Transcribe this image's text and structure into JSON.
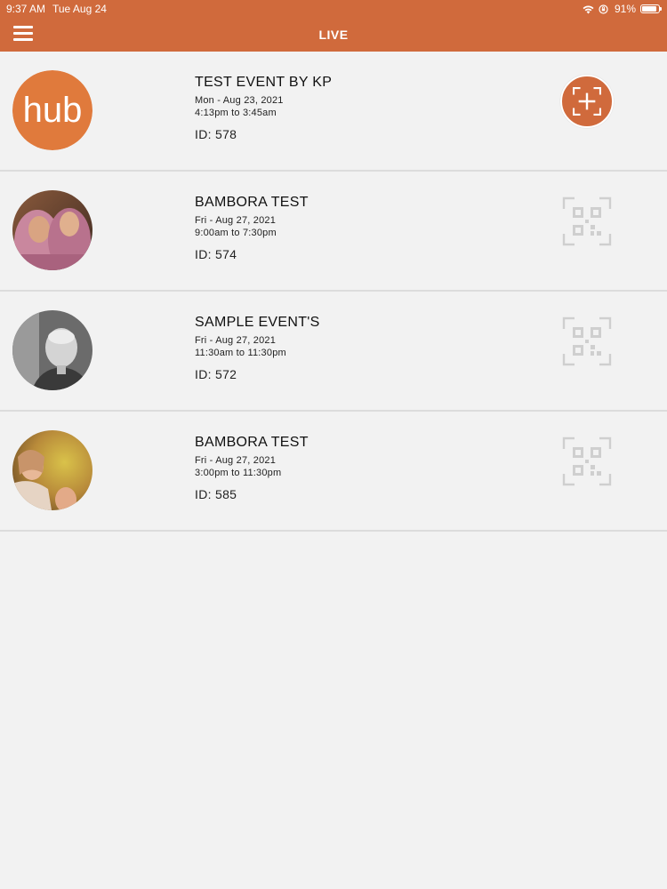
{
  "status_bar": {
    "time": "9:37 AM",
    "date": "Tue Aug 24",
    "battery": "91%"
  },
  "header": {
    "title": "LIVE"
  },
  "events": [
    {
      "title": "TEST EVENT BY KP",
      "date": "Mon - Aug 23, 2021",
      "time": "4:13pm to 3:45am",
      "id": "ID: 578",
      "avatar": "hub-logo",
      "action": "add-scan"
    },
    {
      "title": "BAMBORA TEST",
      "date": "Fri - Aug 27, 2021",
      "time": "9:00am to 7:30pm",
      "id": "ID: 574",
      "avatar": "photo-two-women",
      "action": "qr-scan"
    },
    {
      "title": "SAMPLE EVENT'S",
      "date": "Fri - Aug 27, 2021",
      "time": "11:30am to 11:30pm",
      "id": "ID: 572",
      "avatar": "photo-elderly-man",
      "action": "qr-scan"
    },
    {
      "title": "BAMBORA TEST",
      "date": "Fri - Aug 27, 2021",
      "time": "3:00pm to 11:30pm",
      "id": "ID: 585",
      "avatar": "photo-woman-autumn",
      "action": "qr-scan"
    }
  ],
  "colors": {
    "header": "#d06a3c",
    "accent": "#e07a3c",
    "background": "#f2f2f2",
    "qr_icon": "#cfcfcf"
  },
  "avatar_logo_text": "hub"
}
